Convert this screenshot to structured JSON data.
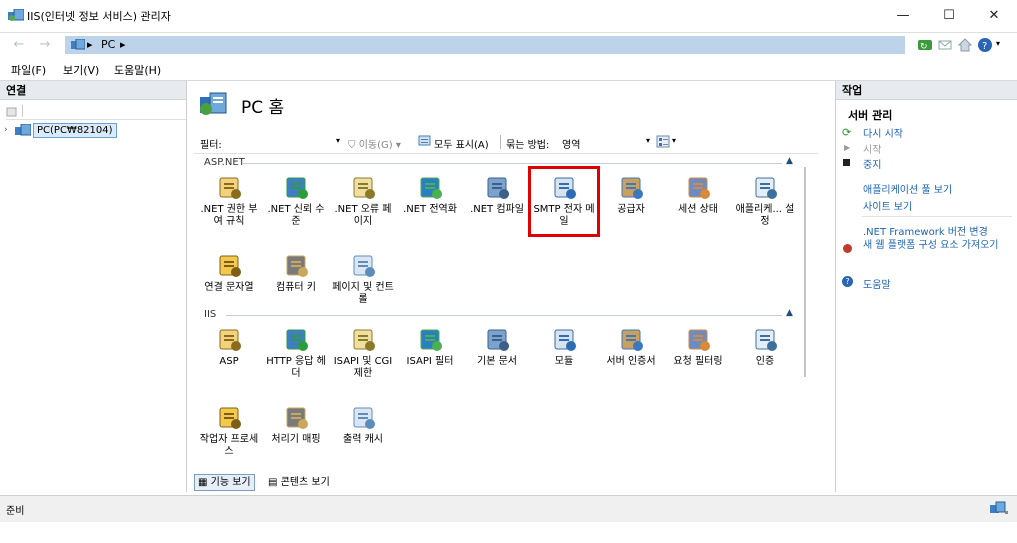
{
  "window": {
    "title": "IIS(인터넷 정보 서비스) 관리자",
    "min": "—",
    "max": "☐",
    "close": "✕"
  },
  "address": {
    "crumbs": [
      "PC"
    ]
  },
  "menu": [
    "파일(F)",
    "보기(V)",
    "도움말(H)"
  ],
  "left": {
    "header": "연결",
    "tree_node": "PC(PC₩82104)"
  },
  "center": {
    "title": "PC 홈",
    "filter_label": "필터:",
    "go_label": "이동(G)",
    "show_all_label": "모두 표시(A)",
    "groupby_label": "묶는 방법:",
    "groupby_value": "영역",
    "groups": [
      {
        "name": "ASP.NET",
        "items": [
          {
            "label": ".NET 권한 부여 규칙",
            "icon": "net-authorization-icon"
          },
          {
            "label": ".NET 신뢰 수준",
            "icon": "net-trust-icon"
          },
          {
            "label": ".NET 오류 페이지",
            "icon": "net-error-pages-icon"
          },
          {
            "label": ".NET 전역화",
            "icon": "net-globalization-icon"
          },
          {
            "label": ".NET 컴파일",
            "icon": "net-compilation-icon"
          },
          {
            "label": "SMTP 전자 메일",
            "icon": "smtp-email-icon",
            "highlighted": true
          },
          {
            "label": "공급자",
            "icon": "providers-icon"
          },
          {
            "label": "세션 상태",
            "icon": "session-state-icon"
          },
          {
            "label": "애플리케... 설정",
            "icon": "app-settings-icon"
          },
          {
            "label": "연결 문자열",
            "icon": "connection-strings-icon"
          },
          {
            "label": "컴퓨터 키",
            "icon": "machine-key-icon"
          },
          {
            "label": "페이지 및 컨트롤",
            "icon": "pages-controls-icon"
          }
        ]
      },
      {
        "name": "IIS",
        "items": [
          {
            "label": "ASP",
            "icon": "asp-icon"
          },
          {
            "label": "HTTP 응답 헤더",
            "icon": "http-headers-icon"
          },
          {
            "label": "ISAPI 및 CGI 제한",
            "icon": "isapi-cgi-icon"
          },
          {
            "label": "ISAPI 필터",
            "icon": "isapi-filters-icon"
          },
          {
            "label": "기본 문서",
            "icon": "default-document-icon"
          },
          {
            "label": "모듈",
            "icon": "modules-icon"
          },
          {
            "label": "서버 인증서",
            "icon": "server-certificates-icon"
          },
          {
            "label": "요청 필터링",
            "icon": "request-filtering-icon"
          },
          {
            "label": "인증",
            "icon": "authentication-icon"
          },
          {
            "label": "작업자 프로세스",
            "icon": "worker-processes-icon"
          },
          {
            "label": "처리기 매핑",
            "icon": "handler-mappings-icon"
          },
          {
            "label": "출력 캐시",
            "icon": "output-cache-icon"
          }
        ]
      }
    ],
    "view_tabs": [
      "기능 보기",
      "콘텐츠 보기"
    ]
  },
  "actions": {
    "header": "작업",
    "section": "서버 관리",
    "items": [
      "다시 시작",
      "시작",
      "중지",
      "애플리케이션 풀 보기",
      "사이트 보기",
      ".NET Framework 버전 변경",
      "새 웹 플랫폼 구성 요소 가져오기",
      "도움말"
    ]
  },
  "status": {
    "text": "준비"
  },
  "colors": {
    "accent": "#1e64b4",
    "highlight": "#e00000",
    "address_bg": "#bcd3ea"
  }
}
